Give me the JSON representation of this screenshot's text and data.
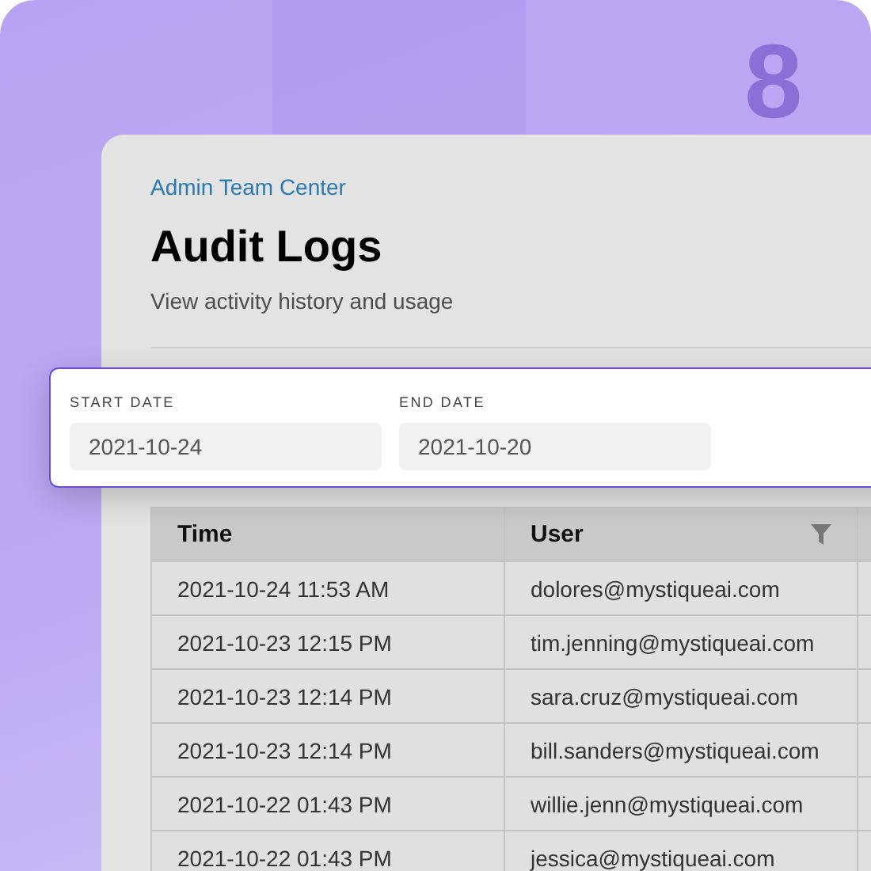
{
  "background_glyph": "8",
  "header": {
    "breadcrumb": "Admin Team Center",
    "title": "Audit Logs",
    "subtitle": "View activity history and usage"
  },
  "date_filter": {
    "fields": [
      {
        "label": "START DATE",
        "value": "2021-10-24"
      },
      {
        "label": "END DATE",
        "value": "2021-10-20"
      }
    ]
  },
  "table": {
    "columns": [
      {
        "label": "Time",
        "filter": false
      },
      {
        "label": "User",
        "filter": true
      }
    ],
    "rows": [
      {
        "time": "2021-10-24 11:53 AM",
        "user": "dolores@mystiqueai.com"
      },
      {
        "time": "2021-10-23 12:15 PM",
        "user": "tim.jenning@mystiqueai.com"
      },
      {
        "time": "2021-10-23 12:14 PM",
        "user": "sara.cruz@mystiqueai.com"
      },
      {
        "time": "2021-10-23 12:14 PM",
        "user": "bill.sanders@mystiqueai.com"
      },
      {
        "time": "2021-10-22 01:43 PM",
        "user": "willie.jenn@mystiqueai.com"
      },
      {
        "time": "2021-10-22 01:43 PM",
        "user": "jessica@mystiqueai.com"
      }
    ]
  }
}
